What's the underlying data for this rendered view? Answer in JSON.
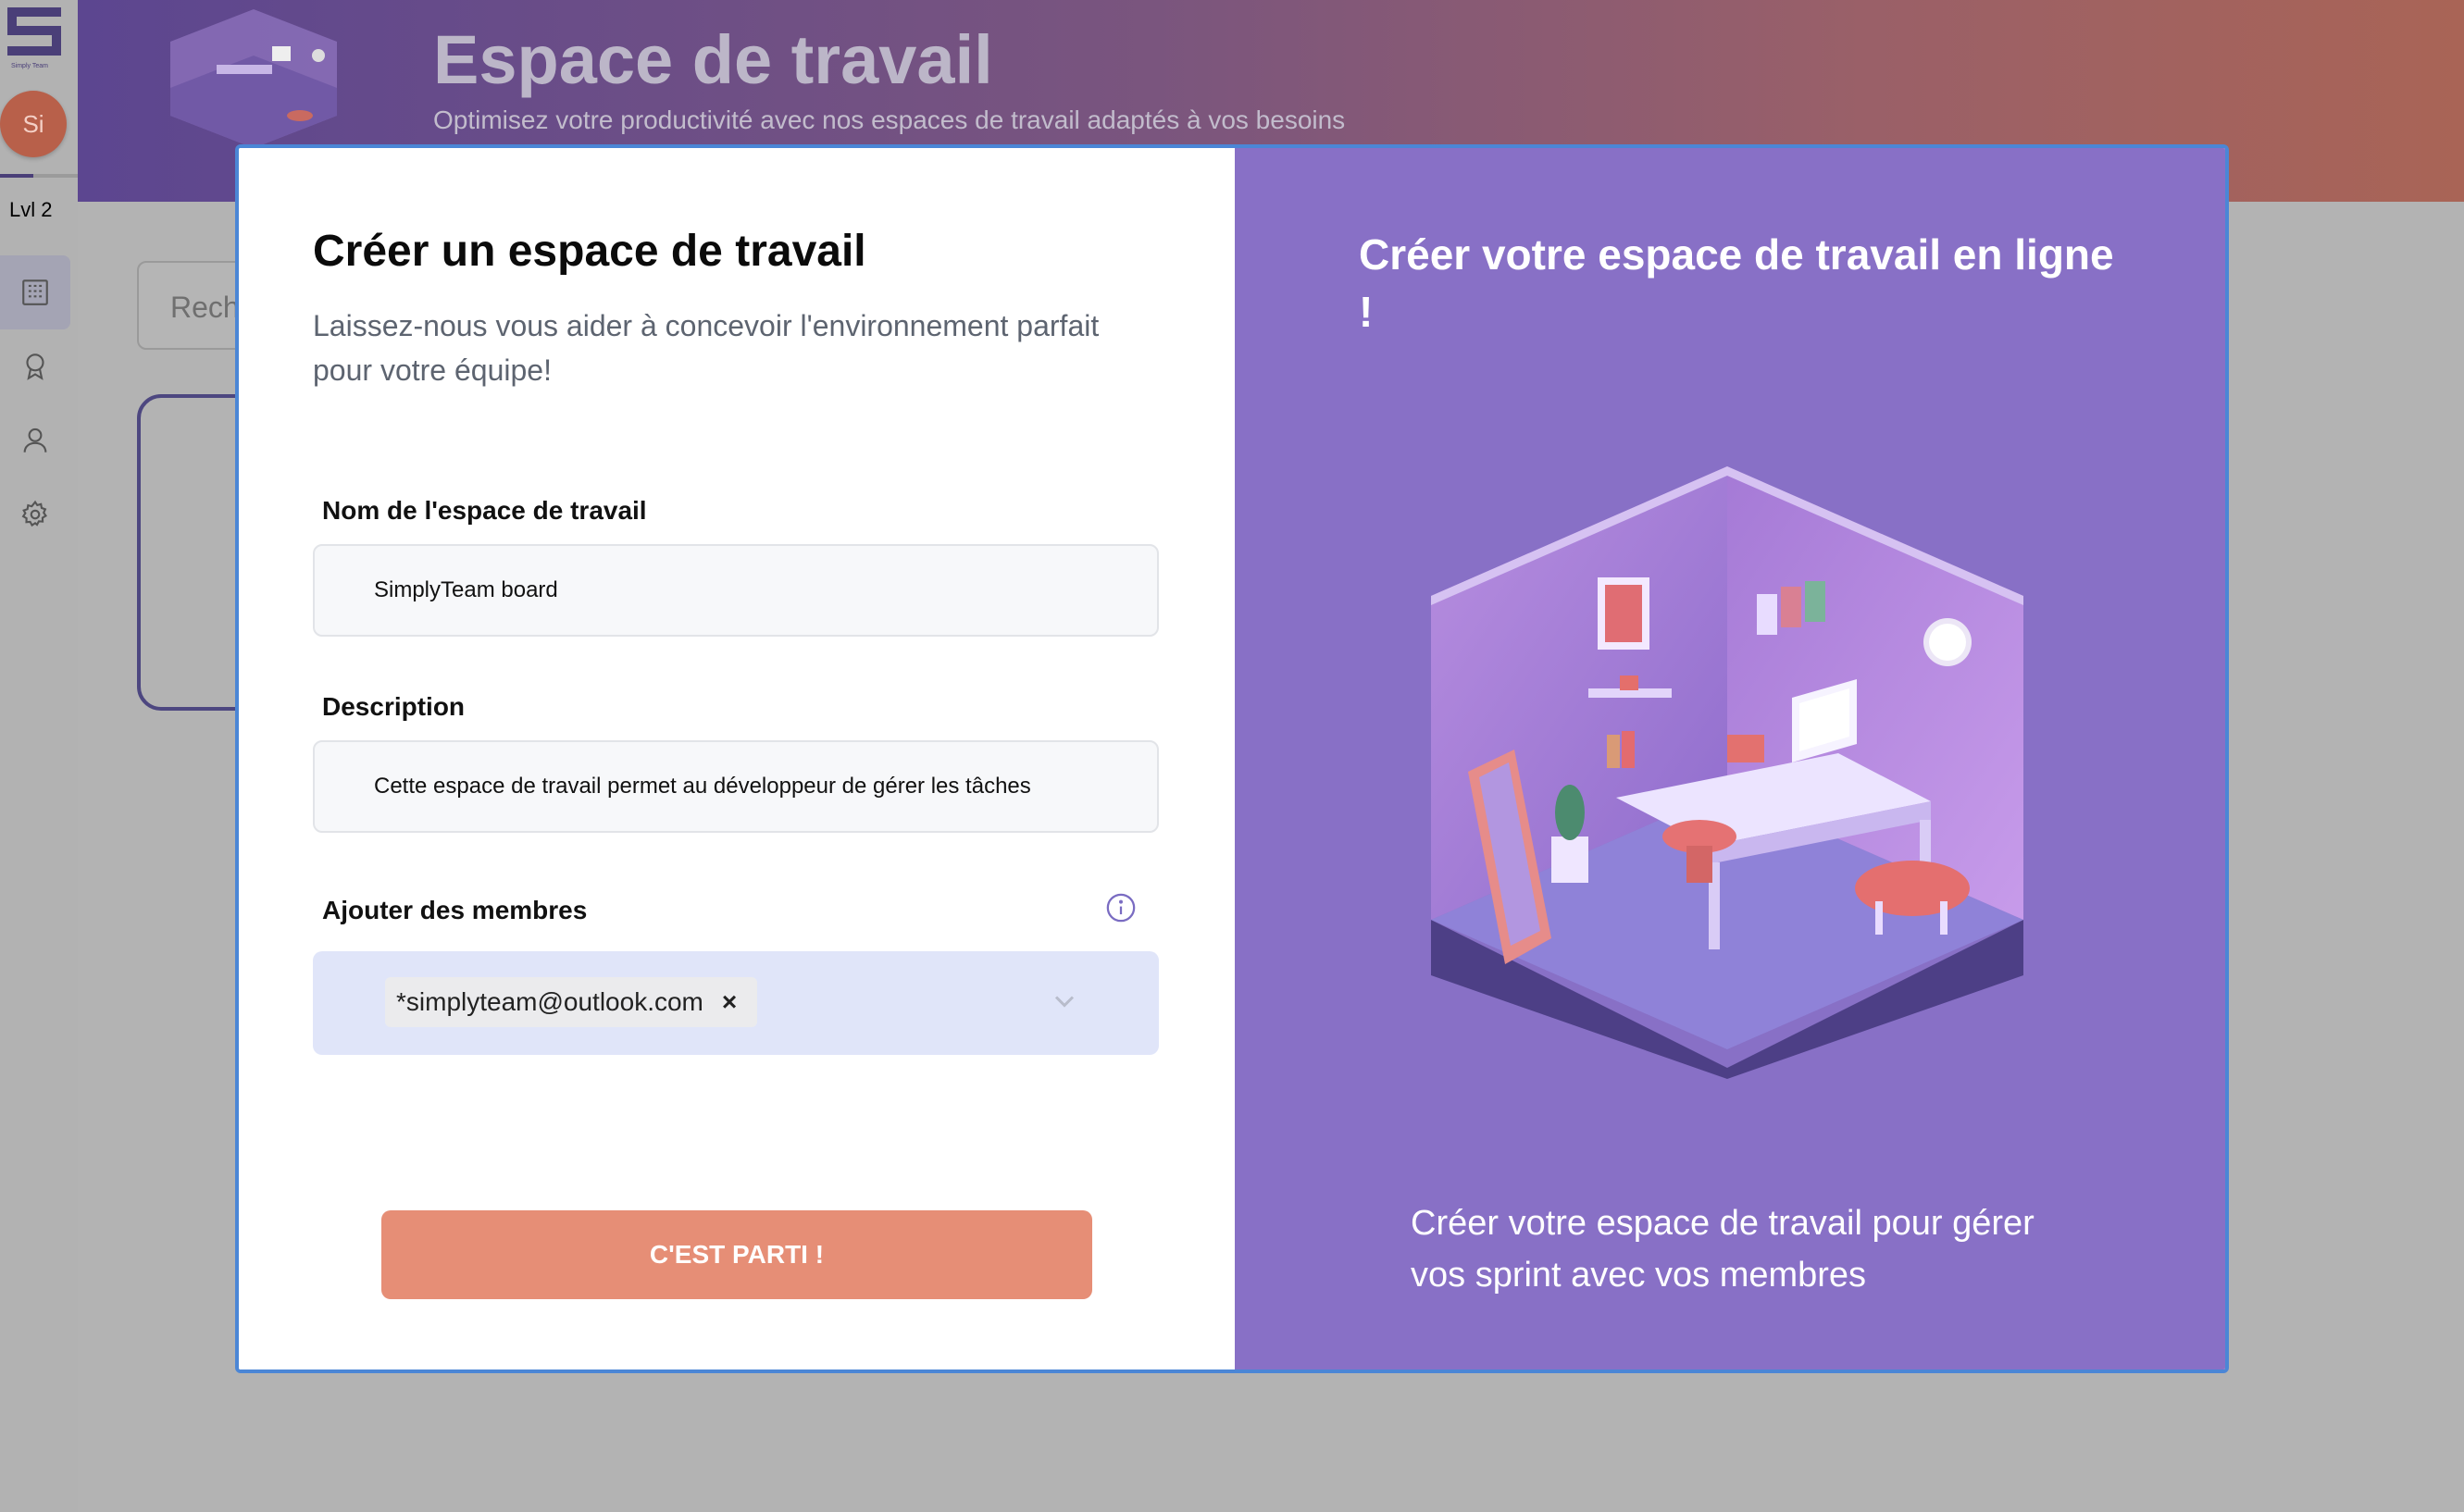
{
  "app": {
    "logo_caption": "Simply Team",
    "avatar_initials": "Si",
    "level_label": "Lvl 2",
    "level_progress": 0.43,
    "nav": [
      {
        "name": "workspaces",
        "icon": "building-icon",
        "active": true
      },
      {
        "name": "achievements",
        "icon": "award-icon",
        "active": false
      },
      {
        "name": "profile",
        "icon": "user-icon",
        "active": false
      },
      {
        "name": "settings",
        "icon": "gear-icon",
        "active": false
      }
    ]
  },
  "header": {
    "title": "Espace de travail",
    "subtitle": "Optimisez votre productivité avec nos espaces de travail adaptés à vos besoins"
  },
  "search": {
    "placeholder_visible": "Rech"
  },
  "modal": {
    "title": "Créer un espace de travail",
    "subtitle": "Laissez-nous vous aider à concevoir l'environnement parfait pour votre équipe!",
    "name_label": "Nom de l'espace de travail",
    "name_value": "SimplyTeam board",
    "description_label": "Description",
    "description_value": "Cette espace de travail permet au développeur de gérer les tâches",
    "members_label": "Ajouter des membres",
    "members": [
      "*simplyteam@outlook.com"
    ],
    "chip_remove": "×",
    "submit_label": "C'EST PARTI !",
    "right_title": "Créer votre espace de travail en ligne !",
    "right_caption": "Créer votre espace de travail pour gérer vos sprint avec vos membres"
  },
  "colors": {
    "accent_purple": "#8870c6",
    "button": "#e68e76",
    "modal_border": "#4b86d6",
    "avatar": "#b8604a"
  }
}
